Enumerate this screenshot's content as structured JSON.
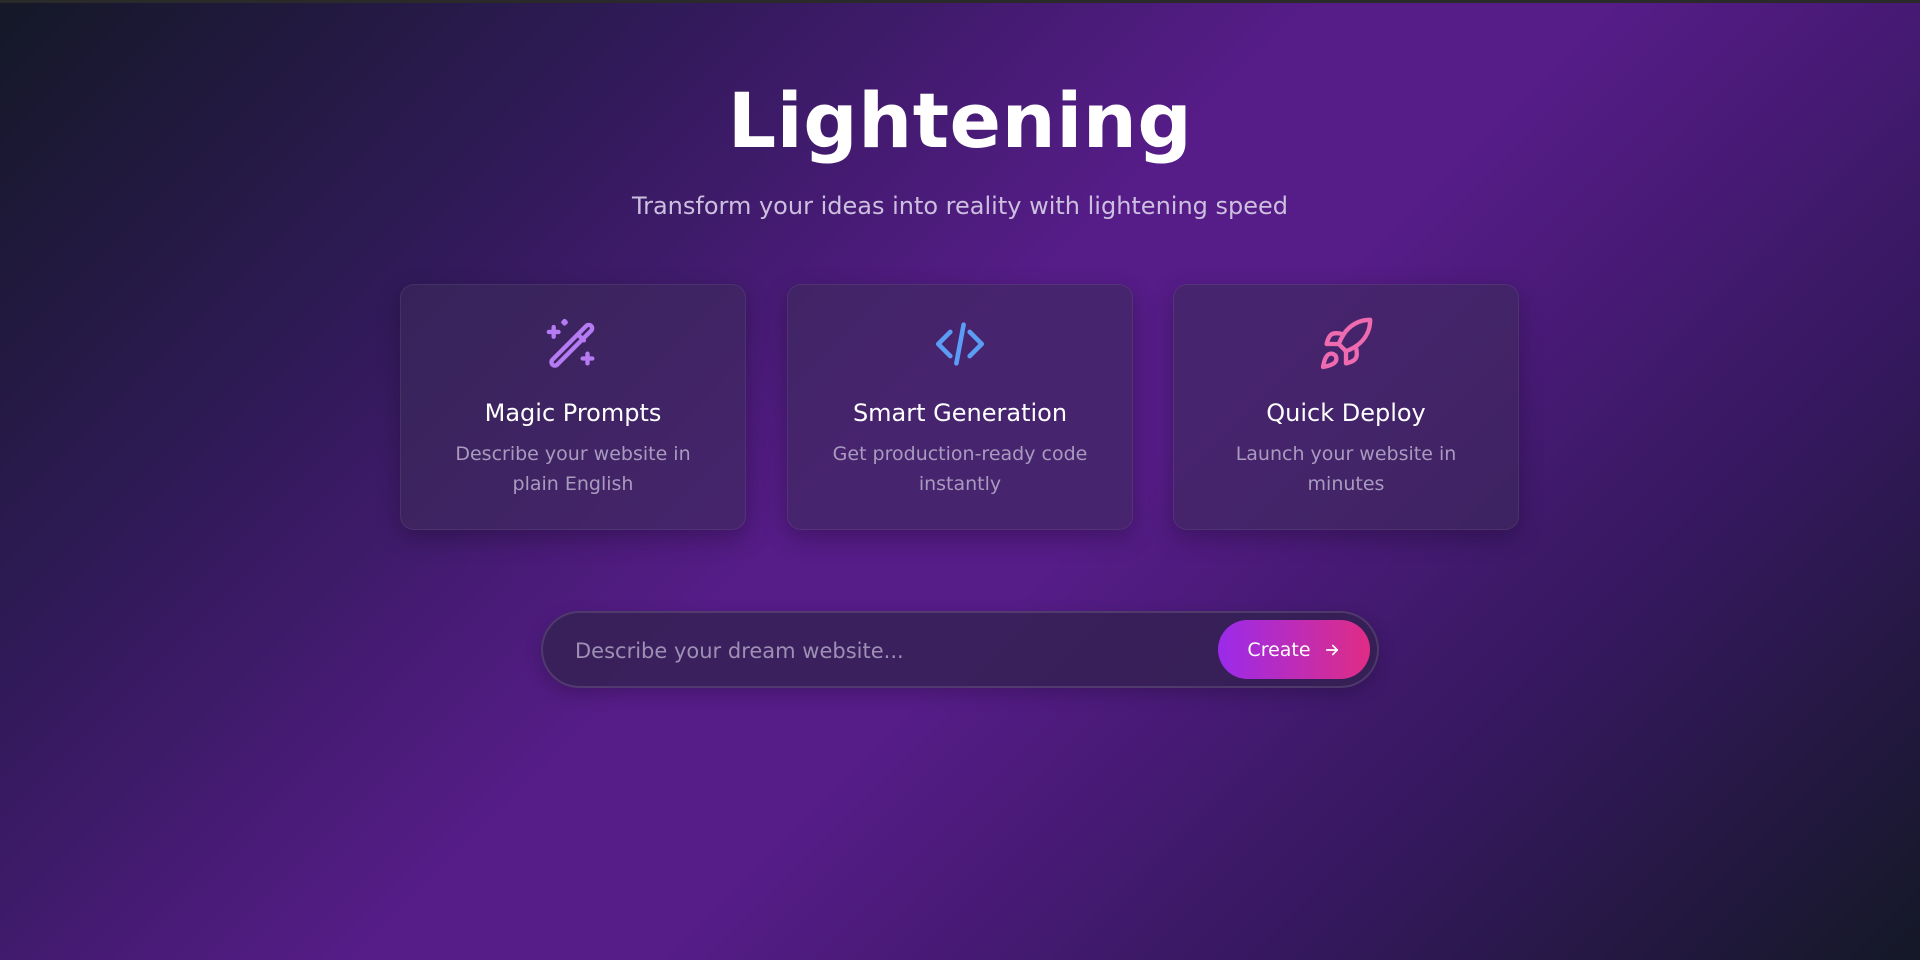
{
  "app": {
    "title": "Lightening",
    "subtitle": "Transform your ideas into reality with lightening speed"
  },
  "features": [
    {
      "title": "Magic Prompts",
      "description": "Describe your website in plain English",
      "icon": "magic-wand-icon",
      "color": "#b57bf2"
    },
    {
      "title": "Smart Generation",
      "description": "Get production-ready code instantly",
      "icon": "code-icon",
      "color": "#5b9cf5"
    },
    {
      "title": "Quick Deploy",
      "description": "Launch your website in minutes",
      "icon": "rocket-icon",
      "color": "#ee6bb0"
    }
  ],
  "prompt": {
    "placeholder": "Describe your dream website...",
    "value": "",
    "button_label": "Create",
    "button_icon": "arrow-right-icon"
  },
  "colors": {
    "accent_start": "#9a2bea",
    "accent_end": "#e02c85",
    "background": "#561c88"
  }
}
